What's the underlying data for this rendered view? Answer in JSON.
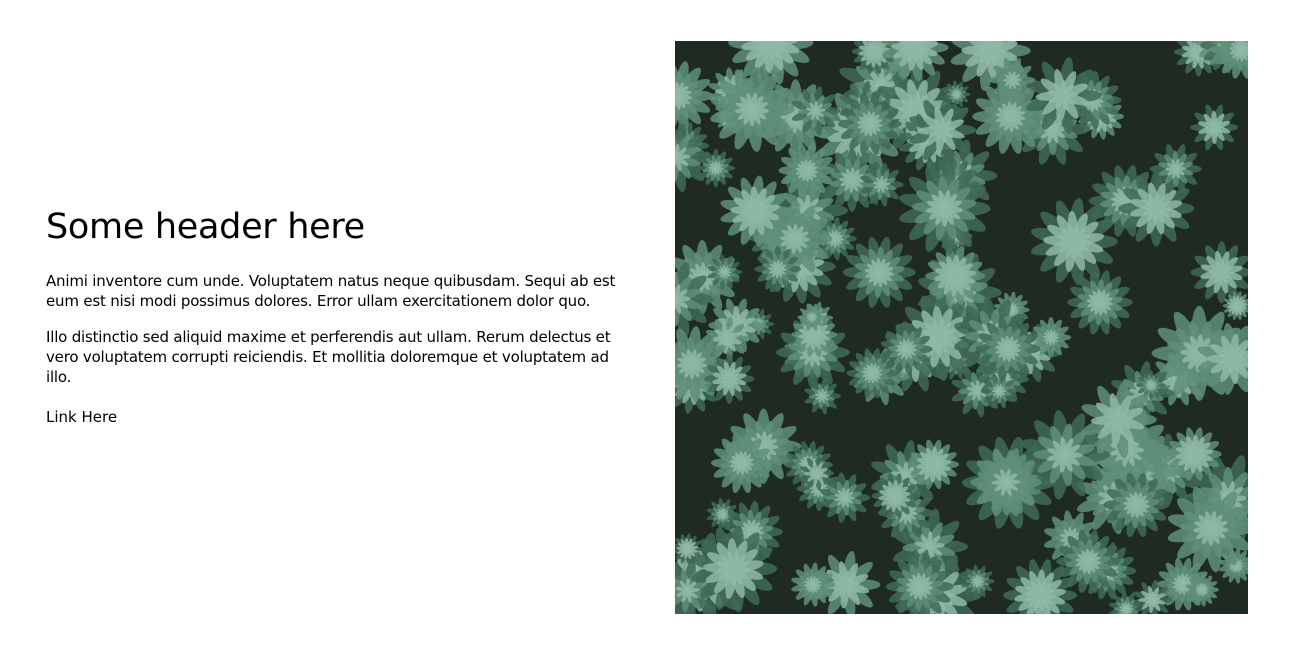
{
  "content": {
    "header": "Some header here",
    "paragraphs": [
      "Animi inventore cum unde. Voluptatem natus neque quibusdam. Sequi ab est eum est nisi modi possimus dolores. Error ullam exercitationem dolor quo.",
      "Illo distinctio sed aliquid maxime et perferendis aut ullam. Rerum delectus et vero voluptatem corrupti reiciendis. Et mollitia doloremque et voluptatem ad illo."
    ],
    "link_label": "Link Here"
  },
  "image": {
    "subject": "succulent-plants-photo",
    "colors": {
      "background": "#1f2b22",
      "leaf_dark": "#3f6a56",
      "leaf_mid": "#5f8f78",
      "leaf_light": "#8fb8a4"
    }
  }
}
